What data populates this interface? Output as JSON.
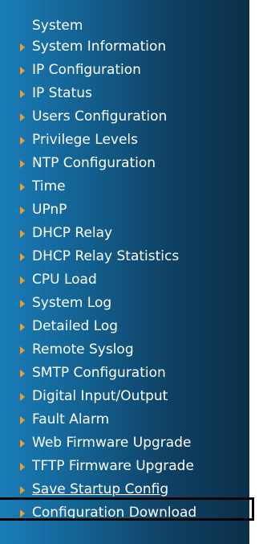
{
  "menu": {
    "heading": "System",
    "items": [
      {
        "label": "System Information"
      },
      {
        "label": "IP Configuration"
      },
      {
        "label": "IP Status"
      },
      {
        "label": "Users Configuration"
      },
      {
        "label": "Privilege Levels"
      },
      {
        "label": "NTP Configuration"
      },
      {
        "label": "Time"
      },
      {
        "label": "UPnP"
      },
      {
        "label": "DHCP Relay"
      },
      {
        "label": "DHCP Relay Statistics"
      },
      {
        "label": "CPU Load"
      },
      {
        "label": "System Log"
      },
      {
        "label": "Detailed Log"
      },
      {
        "label": "Remote Syslog"
      },
      {
        "label": "SMTP Configuration"
      },
      {
        "label": "Digital Input/Output"
      },
      {
        "label": "Fault Alarm"
      },
      {
        "label": "Web Firmware Upgrade"
      },
      {
        "label": "TFTP Firmware Upgrade"
      },
      {
        "label": "Save Startup Config"
      },
      {
        "label": "Configuration Download"
      }
    ],
    "selected_item": "Save Startup Config",
    "colors": {
      "panel_light": "#1a7db8",
      "panel_dark": "#0b2f49",
      "text": "#ffffff",
      "arrow": "#f0a020",
      "highlight_border": "#000000"
    },
    "icon": "triangle-right-icon"
  }
}
